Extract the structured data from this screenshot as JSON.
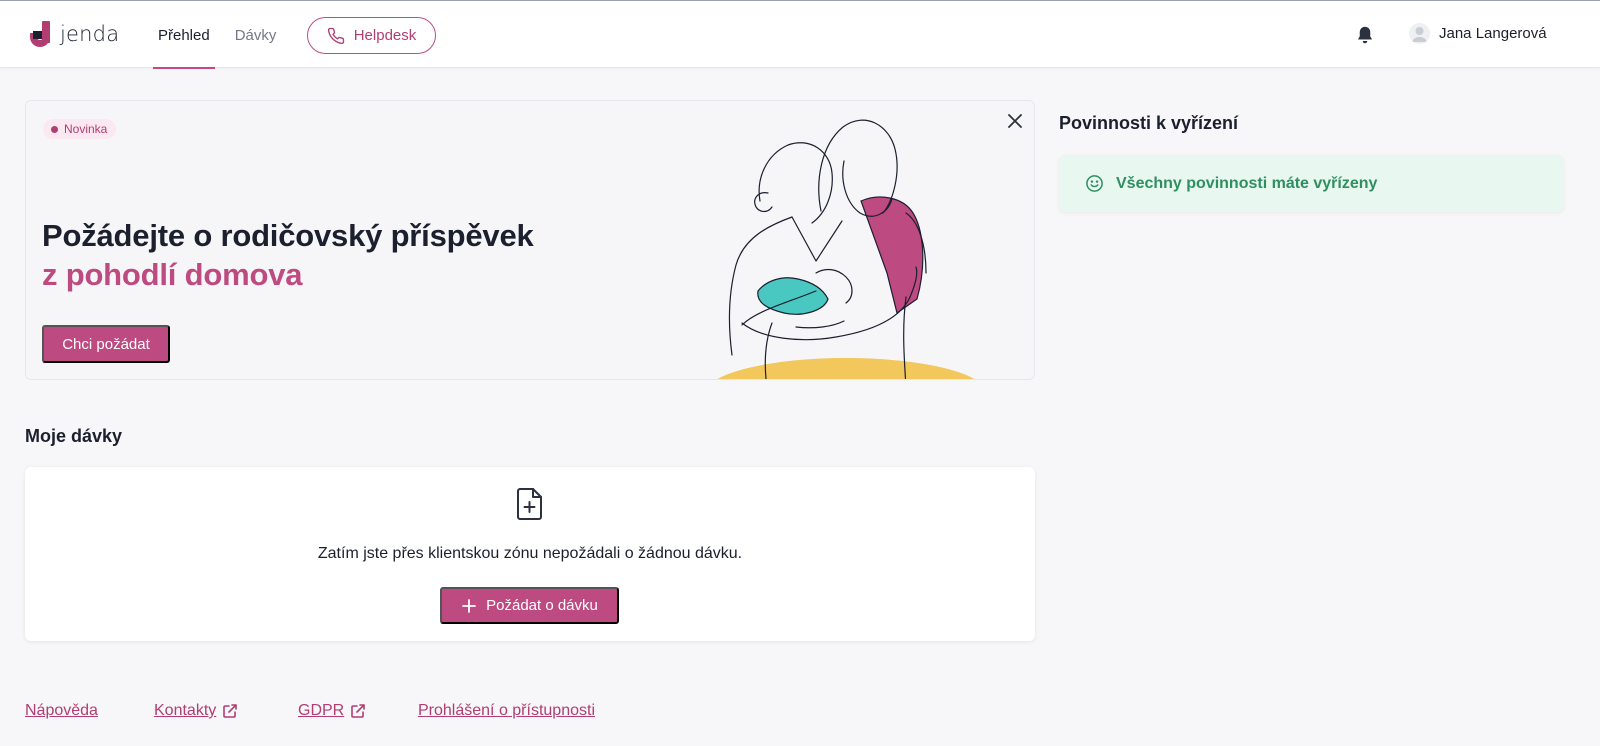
{
  "header": {
    "logo_text": "jenda",
    "nav": [
      {
        "label": "Přehled",
        "active": true
      },
      {
        "label": "Dávky",
        "active": false
      }
    ],
    "helpdesk_label": "Helpdesk",
    "user_name": "Jana Langerová"
  },
  "banner": {
    "badge": "Novinka",
    "title": "Požádejte o rodičovský příspěvek",
    "subtitle": "z pohodlí domova",
    "cta_label": "Chci požádat"
  },
  "duties": {
    "title": "Povinnosti k vyřízení",
    "status_text": "Všechny povinnosti máte vyřízeny"
  },
  "benefits": {
    "title": "Moje dávky",
    "empty_text": "Zatím jste přes klientskou zónu nepožádali o žádnou dávku.",
    "request_label": "Požádat o dávku"
  },
  "footer": {
    "links": [
      "Nápověda",
      "Kontakty",
      "GDPR",
      "Prohlášení o přístupnosti"
    ]
  },
  "colors": {
    "brand": "#bd4a80",
    "success": "#2f8f5f",
    "success_bg": "#e8f7f0",
    "illustration_teal": "#49c8c1",
    "illustration_yellow": "#f2c75c"
  }
}
